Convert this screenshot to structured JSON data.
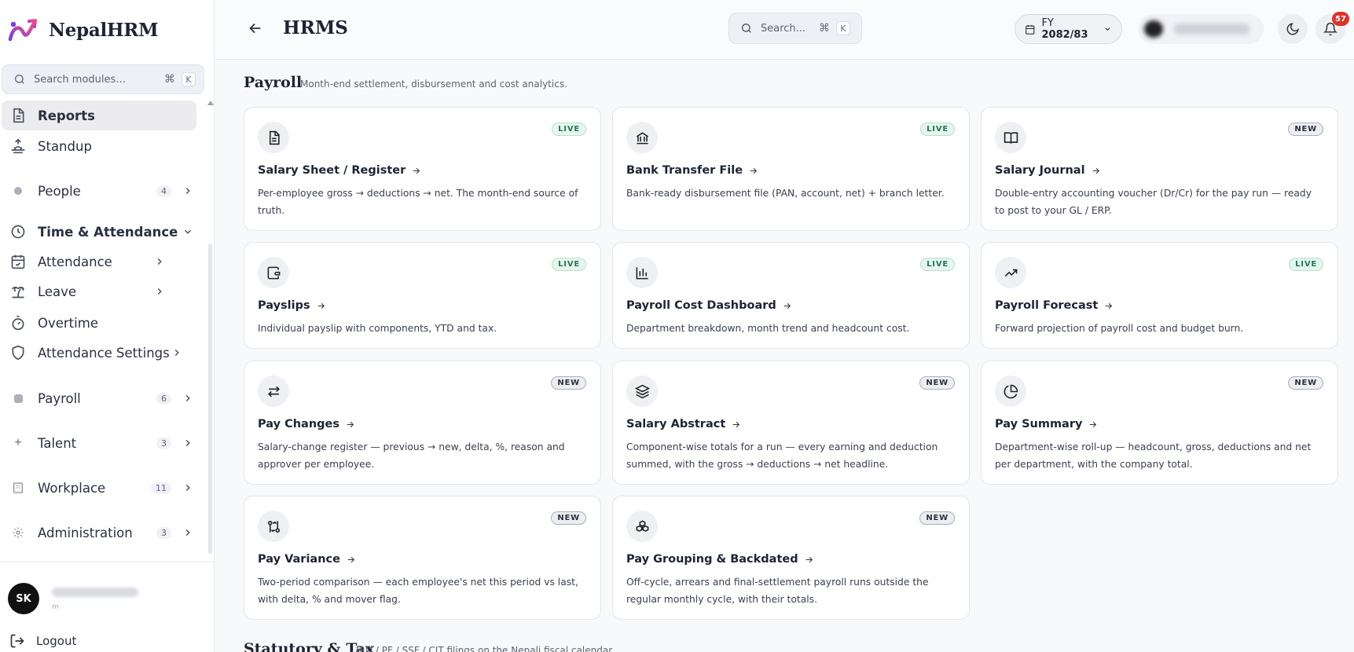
{
  "brand": {
    "name": "NepalHRM"
  },
  "sidebar": {
    "search_placeholder": "Search modules…",
    "shortcut_cmd": "⌘",
    "shortcut_key": "K",
    "items": [
      {
        "label": "Reports",
        "icon": "document-icon"
      },
      {
        "label": "Standup",
        "icon": "sunrise-icon"
      },
      {
        "label": "People",
        "badge": "4",
        "icon": "users-icon"
      },
      {
        "label": "Time & Attendance",
        "icon": "clock-icon"
      },
      {
        "label": "Attendance",
        "icon": "calendar-check-icon"
      },
      {
        "label": "Leave",
        "icon": "palm-tree-icon"
      },
      {
        "label": "Overtime",
        "icon": "timer-icon"
      },
      {
        "label": "Attendance Settings",
        "icon": "shield-icon"
      },
      {
        "label": "Payroll",
        "badge": "6",
        "icon": "wallet-icon"
      },
      {
        "label": "Talent",
        "badge": "3",
        "icon": "sparkles-icon"
      },
      {
        "label": "Workplace",
        "badge": "11",
        "icon": "building-icon"
      },
      {
        "label": "Administration",
        "badge": "3",
        "icon": "gear-icon"
      }
    ],
    "user": {
      "initials": "SK",
      "role": "m"
    },
    "logout_label": "Logout"
  },
  "header": {
    "title": "HRMS",
    "search_placeholder": "Search...",
    "shortcut_cmd": "⌘",
    "shortcut_key": "K",
    "fy_prefix": "FY ",
    "fy_value": "2082/83",
    "notification_count": "57"
  },
  "section": {
    "title": "Payroll",
    "subtitle": "Month-end settlement, disbursement and cost analytics."
  },
  "section2": {
    "title": "Statutory & Tax",
    "subtitle": "IRD / PF / SSF / CIT filings on the Nepali fiscal calendar."
  },
  "cards": [
    {
      "title": "Salary Sheet / Register",
      "desc": "Per-employee gross → deductions → net. The month-end source of truth.",
      "tag": "LIVE",
      "icon": "file-text-icon"
    },
    {
      "title": "Bank Transfer File",
      "desc": "Bank-ready disbursement file (PAN, account, net) + branch letter.",
      "tag": "LIVE",
      "icon": "bank-icon"
    },
    {
      "title": "Salary Journal",
      "desc": "Double-entry accounting voucher (Dr/Cr) for the pay run — ready to post to your GL / ERP.",
      "tag": "NEW",
      "icon": "book-open-icon"
    },
    {
      "title": "Payslips",
      "desc": "Individual payslip with components, YTD and tax.",
      "tag": "LIVE",
      "icon": "wallet-icon"
    },
    {
      "title": "Payroll Cost Dashboard",
      "desc": "Department breakdown, month trend and headcount cost.",
      "tag": "LIVE",
      "icon": "bar-chart-icon"
    },
    {
      "title": "Payroll Forecast",
      "desc": "Forward projection of payroll cost and budget burn.",
      "tag": "LIVE",
      "icon": "trending-up-icon"
    },
    {
      "title": "Pay Changes",
      "desc": "Salary-change register — previous → new, delta, %, reason and approver per employee.",
      "tag": "NEW",
      "icon": "arrows-swap-icon"
    },
    {
      "title": "Salary Abstract",
      "desc": "Component-wise totals for a run — every earning and deduction summed, with the gross → deductions → net headline.",
      "tag": "NEW",
      "icon": "layers-icon"
    },
    {
      "title": "Pay Summary",
      "desc": "Department-wise roll-up — headcount, gross, deductions and net per department, with the company total.",
      "tag": "NEW",
      "icon": "pie-chart-icon"
    },
    {
      "title": "Pay Variance",
      "desc": "Two-period comparison — each employee's net this period vs last, with delta, % and mover flag.",
      "tag": "NEW",
      "icon": "git-compare-icon"
    },
    {
      "title": "Pay Grouping & Backdated",
      "desc": "Off-cycle, arrears and final-settlement payroll runs outside the regular monthly cycle, with their totals.",
      "tag": "NEW",
      "icon": "boxes-icon"
    }
  ]
}
